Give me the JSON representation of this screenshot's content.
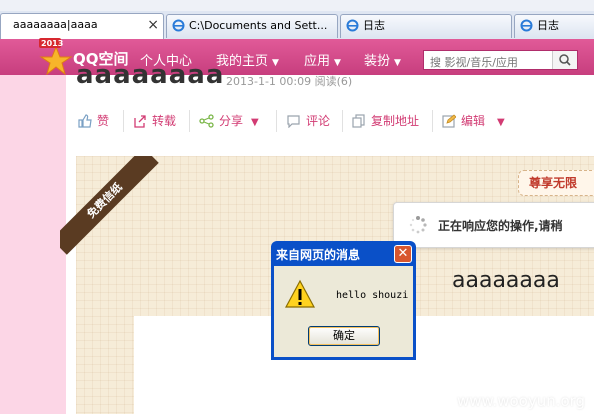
{
  "browser": {
    "tabs": [
      {
        "label": "aaaaaaaa|aaaa",
        "active": true
      },
      {
        "label": "C:\\Documents and Sett...",
        "active": false
      },
      {
        "label": "日志",
        "active": false
      },
      {
        "label": "日志",
        "active": false
      }
    ],
    "close_glyph": "×"
  },
  "nav": {
    "badge_year": "2013",
    "logo": "QQ空间",
    "items": [
      {
        "label": "个人中心",
        "has_caret": false
      },
      {
        "label": "我的主页",
        "has_caret": true
      },
      {
        "label": "应用",
        "has_caret": true
      },
      {
        "label": "装扮",
        "has_caret": true
      }
    ],
    "search": {
      "placeholder": "搜 影视/音乐/应用"
    }
  },
  "post": {
    "title": "aaaaaaaa",
    "meta": "2013-1-1 00:09 阅读(6)"
  },
  "toolbar": {
    "items": [
      {
        "label": "赞",
        "icon": "thumbs-up-icon"
      },
      {
        "label": "转载",
        "icon": "share-out-icon"
      },
      {
        "label": "分享",
        "icon": "share-nodes-icon",
        "has_caret": true
      },
      {
        "label": "评论",
        "icon": "comment-icon"
      },
      {
        "label": "复制地址",
        "icon": "copy-icon"
      },
      {
        "label": "编辑",
        "icon": "edit-icon",
        "has_caret": true
      }
    ]
  },
  "letter": {
    "ribbon": "免费信纸",
    "vip_badge": "尊享无限",
    "loading": "正在响应您的操作,请稍",
    "body_text": "aaaaaaaa"
  },
  "dialog": {
    "title": "来自网页的消息",
    "message": "hello shouzi",
    "ok_label": "确定",
    "close_glyph": "✕"
  },
  "watermark": "www.wooyun.org",
  "colors": {
    "nav_pink": "#d34b8a",
    "accent": "#d23b73",
    "dialog_blue": "#0a50c8",
    "left_pink": "#fcd6e6"
  }
}
